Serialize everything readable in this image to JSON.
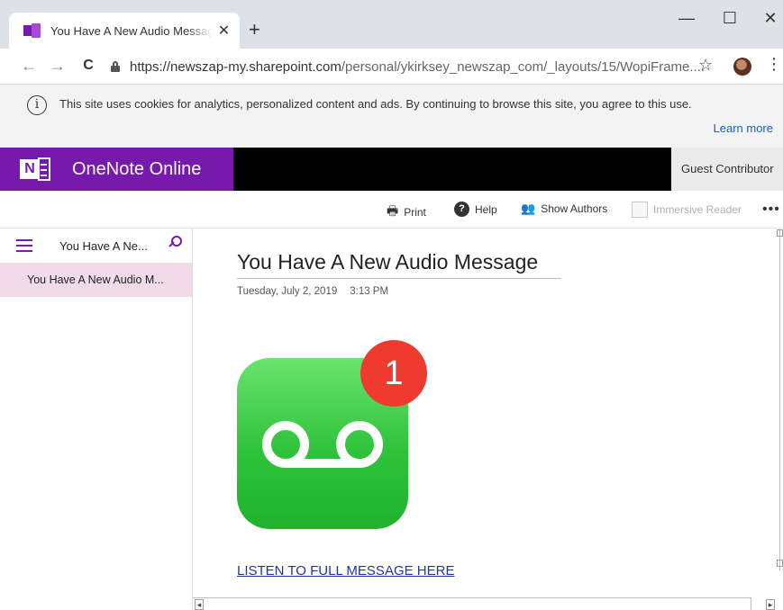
{
  "browser": {
    "tab_title": "You Have A New Audio Message",
    "tab_close": "✕",
    "new_tab": "+",
    "window_controls": {
      "minimize": "—",
      "maximize": "☐",
      "close": "✕"
    },
    "nav": {
      "back": "←",
      "forward": "→",
      "reload": "C"
    },
    "url_host": "https://newszap-my.sharepoint.com",
    "url_path": "/personal/ykirksey_newszap_com/_layouts/15/WopiFrame....",
    "bookmark": "☆",
    "menu": "⋮",
    "icons": {
      "favicon": "onenote-favicon",
      "lock": "lock-icon",
      "avatar": "profile-avatar"
    }
  },
  "cookie_notice": {
    "info_glyph": "i",
    "text": "This site uses cookies for analytics, personalized content and ads. By continuing to browse this site, you agree to this use.",
    "learn_more": "Learn more"
  },
  "app": {
    "logo_letter": "N",
    "name": "OneNote Online",
    "user_label": "Guest Contributor",
    "brand_color": "#7719aa"
  },
  "ribbon": {
    "print": "Print",
    "help": "Help",
    "help_glyph": "?",
    "show_authors": "Show Authors",
    "immersive_reader": "Immersive Reader",
    "more": "•••"
  },
  "nav_pane": {
    "section_title": "You Have A Ne...",
    "pages": [
      "You Have A New Audio M..."
    ]
  },
  "page": {
    "title": "You Have A New Audio Message",
    "date": "Tuesday, July 2, 2019",
    "time": "3:13 PM",
    "badge_count": "1",
    "link_text": "LISTEN TO FULL MESSAGE HERE",
    "voicemail_color": "#2ec23a",
    "badge_color": "#ef3a2f"
  },
  "scroll": {
    "left_arrow": "◂",
    "right_arrow": "▸"
  }
}
